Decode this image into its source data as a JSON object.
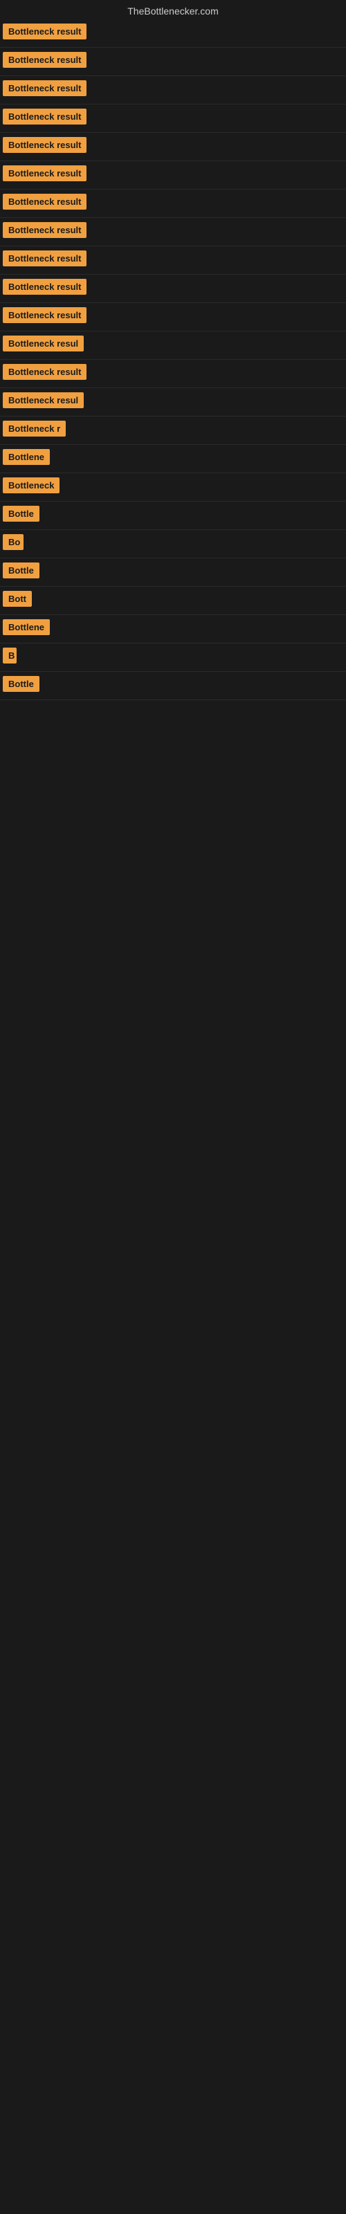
{
  "site": {
    "title": "TheBottlenecker.com"
  },
  "rows": [
    {
      "id": 1,
      "label": "Bottleneck result",
      "clip": false
    },
    {
      "id": 2,
      "label": "Bottleneck result",
      "clip": false
    },
    {
      "id": 3,
      "label": "Bottleneck result",
      "clip": false
    },
    {
      "id": 4,
      "label": "Bottleneck result",
      "clip": false
    },
    {
      "id": 5,
      "label": "Bottleneck result",
      "clip": false
    },
    {
      "id": 6,
      "label": "Bottleneck result",
      "clip": false
    },
    {
      "id": 7,
      "label": "Bottleneck result",
      "clip": false
    },
    {
      "id": 8,
      "label": "Bottleneck result",
      "clip": false
    },
    {
      "id": 9,
      "label": "Bottleneck result",
      "clip": false
    },
    {
      "id": 10,
      "label": "Bottleneck result",
      "clip": false
    },
    {
      "id": 11,
      "label": "Bottleneck result",
      "clip": false
    },
    {
      "id": 12,
      "label": "Bottleneck resul",
      "clip": true,
      "width": 130
    },
    {
      "id": 13,
      "label": "Bottleneck result",
      "clip": false
    },
    {
      "id": 14,
      "label": "Bottleneck resul",
      "clip": true,
      "width": 120
    },
    {
      "id": 15,
      "label": "Bottleneck r",
      "clip": true,
      "width": 95
    },
    {
      "id": 16,
      "label": "Bottlene",
      "clip": true,
      "width": 80
    },
    {
      "id": 17,
      "label": "Bottleneck",
      "clip": true,
      "width": 85
    },
    {
      "id": 18,
      "label": "Bottle",
      "clip": true,
      "width": 60
    },
    {
      "id": 19,
      "label": "Bo",
      "clip": true,
      "width": 30
    },
    {
      "id": 20,
      "label": "Bottle",
      "clip": true,
      "width": 60
    },
    {
      "id": 21,
      "label": "Bott",
      "clip": true,
      "width": 48
    },
    {
      "id": 22,
      "label": "Bottlene",
      "clip": true,
      "width": 72
    },
    {
      "id": 23,
      "label": "B",
      "clip": true,
      "width": 20
    },
    {
      "id": 24,
      "label": "Bottle",
      "clip": true,
      "width": 60
    }
  ]
}
